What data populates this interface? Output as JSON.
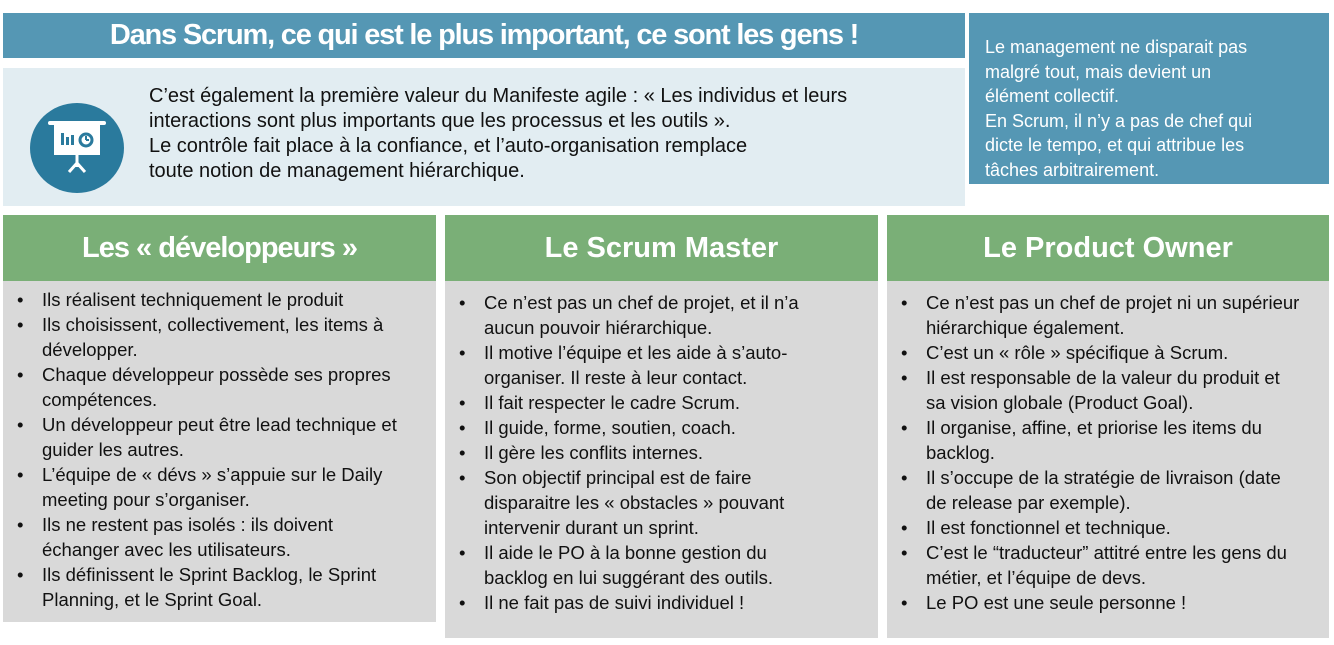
{
  "title": "Dans Scrum, ce qui est le plus important, ce sont les gens !",
  "intro": {
    "icon": "presentation-board-icon",
    "lines": [
      "C’est également la première valeur du Manifeste agile : « Les individus et leurs",
      "interactions sont plus importants que les processus et les outils ».",
      "Le contrôle fait place à la confiance, et l’auto-organisation remplace",
      "toute notion de management hiérarchique."
    ]
  },
  "side_note": {
    "lines": [
      "Le management ne disparait pas",
      "malgré tout, mais devient un",
      "élément collectif.",
      "En Scrum, il n’y a pas de chef qui",
      "dicte le tempo, et qui attribue les",
      "tâches arbitrairement."
    ]
  },
  "columns": [
    {
      "title": "Les « développeurs »",
      "items": [
        "Ils réalisent techniquement le produit",
        "Ils choisissent, collectivement, les items à développer.",
        "Chaque développeur possède ses propres compétences.",
        "Un développeur peut être lead technique et guider les autres.",
        "L’équipe de « dévs » s’appuie sur le Daily meeting pour s’organiser.",
        "Ils ne restent pas isolés : ils doivent échanger avec les utilisateurs.",
        "Ils définissent le Sprint Backlog, le Sprint Planning, et le Sprint Goal."
      ]
    },
    {
      "title": "Le Scrum Master",
      "items": [
        "Ce n’est pas un chef de projet, et il n’a aucun pouvoir hiérarchique.",
        "Il motive l’équipe et les aide à s’auto-organiser. Il reste à leur contact.",
        "Il fait respecter le cadre Scrum.",
        "Il guide, forme, soutien, coach.",
        "Il gère les conflits internes.",
        "Son objectif principal est de faire disparaitre les « obstacles » pouvant intervenir durant un sprint.",
        "Il aide le PO à la bonne gestion du backlog en lui suggérant des outils.",
        "Il ne fait pas de suivi individuel !"
      ]
    },
    {
      "title": "Le Product Owner",
      "items": [
        "Ce n’est pas un chef de projet ni un supérieur hiérarchique également.",
        "C’est un « rôle » spécifique à Scrum.",
        "Il est responsable de la valeur du produit et sa vision globale (Product Goal).",
        "Il organise, affine, et priorise les items du backlog.",
        "Il s’occupe de la stratégie de livraison (date de release par exemple).",
        "Il est fonctionnel et technique.",
        "C’est le “traducteur” attitré entre les gens du métier, et l’équipe de devs.",
        "Le PO est une seule personne !"
      ]
    }
  ]
}
